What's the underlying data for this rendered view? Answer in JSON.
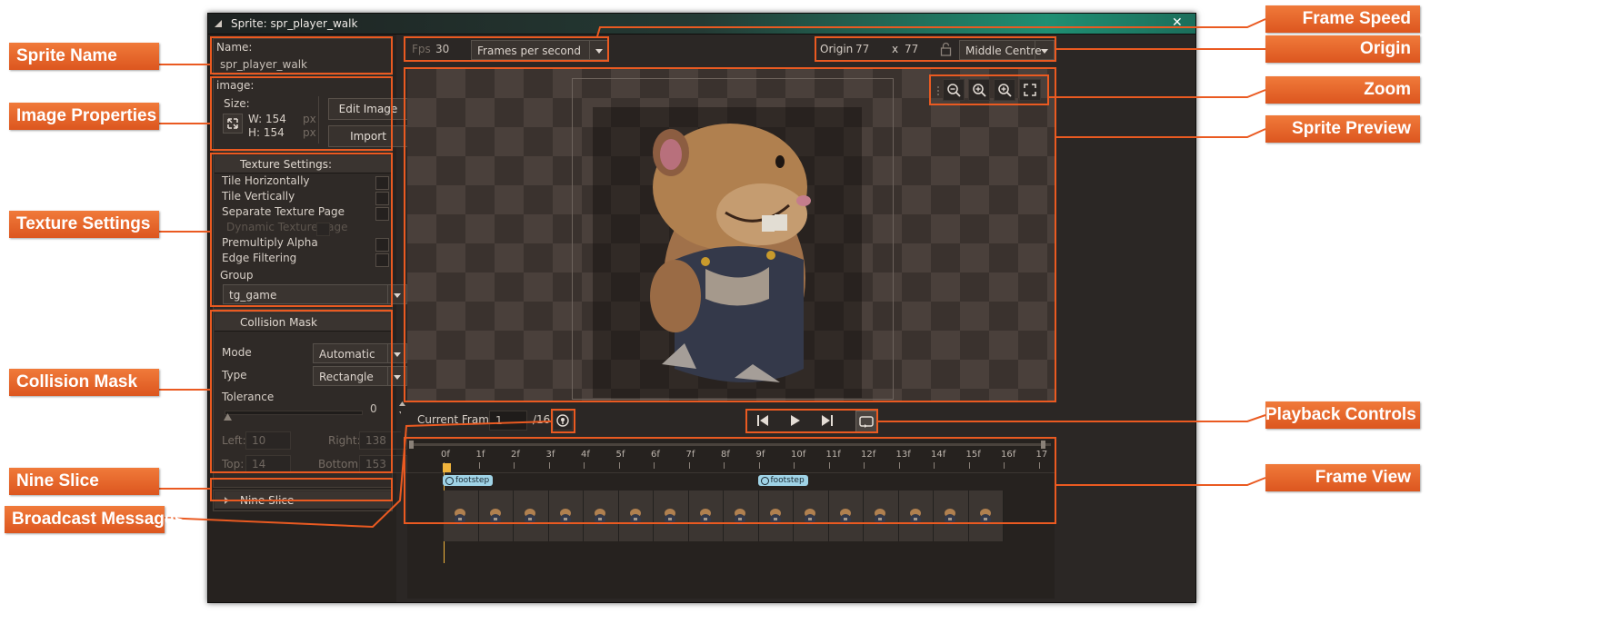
{
  "window": {
    "title": "Sprite: spr_player_walk",
    "close_glyph": "✕"
  },
  "name_section": {
    "label": "Name:",
    "value": "spr_player_walk"
  },
  "image_section": {
    "label": "image:",
    "size_label": "Size:",
    "width": "W: 154",
    "height": "H: 154",
    "unit": "px",
    "edit_button": "Edit Image",
    "import_button": "Import"
  },
  "texture_settings": {
    "header": "Texture Settings:",
    "options": [
      {
        "label": "Tile Horizontally",
        "enabled": true
      },
      {
        "label": "Tile Vertically",
        "enabled": true
      },
      {
        "label": "Separate Texture Page",
        "enabled": true
      },
      {
        "label": "Dynamic Texture Page",
        "enabled": false
      },
      {
        "label": "Premultiply Alpha",
        "enabled": true
      },
      {
        "label": "Edge Filtering",
        "enabled": true
      }
    ],
    "group_label": "Group",
    "group_value": "tg_game"
  },
  "collision_mask": {
    "header": "Collision Mask",
    "mode_label": "Mode",
    "mode_value": "Automatic",
    "type_label": "Type",
    "type_value": "Rectangle",
    "tolerance_label": "Tolerance",
    "tolerance_value": "0",
    "left_label": "Left:",
    "left_value": "10",
    "right_label": "Right:",
    "right_value": "138",
    "top_label": "Top:",
    "top_value": "14",
    "bottom_label": "Bottom:",
    "bottom_value": "153"
  },
  "nine_slice": {
    "header": "Nine Slice"
  },
  "toolbar": {
    "fps_label": "Fps",
    "fps_value": "30",
    "speed_mode": "Frames per second",
    "origin_label": "Origin",
    "origin_x": "77",
    "origin_sep": "x",
    "origin_y": "77",
    "origin_preset": "Middle Centre"
  },
  "frame_controls": {
    "current_frame_label": "Current Frame:",
    "current_frame_value": "1",
    "total_frames": "/16"
  },
  "timeline": {
    "ticks": [
      "0f",
      "1f",
      "2f",
      "3f",
      "4f",
      "5f",
      "6f",
      "7f",
      "8f",
      "9f",
      "10f",
      "11f",
      "12f",
      "13f",
      "14f",
      "15f",
      "16f",
      "17"
    ],
    "events": [
      {
        "label": "footstep",
        "frame": 0
      },
      {
        "label": "footstep",
        "frame": 9
      }
    ],
    "frame_count": 16
  },
  "callouts": {
    "sprite_name": "Sprite Name",
    "image_properties": "Image Properties",
    "texture_settings": "Texture Settings",
    "collision_mask": "Collision Mask",
    "nine_slice": "Nine Slice",
    "broadcast_messages": "Broadcast Messages",
    "frame_speed": "Frame Speed",
    "origin": "Origin",
    "zoom": "Zoom",
    "sprite_preview": "Sprite Preview",
    "playback_controls": "Playback Controls",
    "frame_view": "Frame View"
  },
  "colors": {
    "accent": "#ea5a21",
    "window_bg": "#2b2725",
    "titlebar_teal": "#1f8f73",
    "event_badge": "#9fd3e6"
  },
  "icons": [
    "resize-icon",
    "zoom-out-icon",
    "zoom-in-icon",
    "zoom-reset-icon",
    "fit-icon",
    "lock-icon",
    "broadcast-icon",
    "skip-start-icon",
    "play-icon",
    "skip-end-icon",
    "loop-icon"
  ]
}
